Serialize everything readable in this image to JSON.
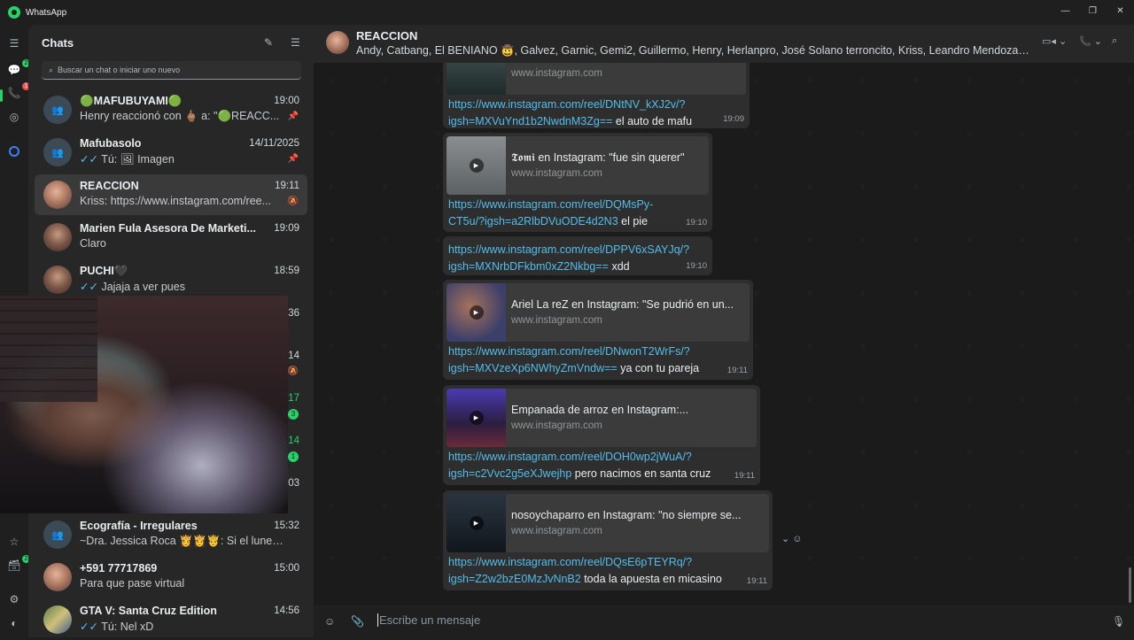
{
  "app": {
    "title": "WhatsApp",
    "window_controls": [
      "minimize",
      "maximize",
      "close"
    ]
  },
  "rail": {
    "badges": {
      "chats": "2",
      "calls": "1",
      "status_bottom": "2"
    },
    "icons": [
      "menu-icon",
      "chats-icon",
      "calls-icon",
      "status-icon",
      "meta-ai-icon",
      "starred-icon",
      "archived-icon",
      "settings-icon",
      "profile-icon"
    ]
  },
  "sidebar": {
    "title": "Chats",
    "search_placeholder": "Buscar un chat o iniciar uno nuevo",
    "chats": [
      {
        "name": "🟢MAFUBUYAMI🟢",
        "time": "19:00",
        "preview": "Henry reaccionó con 🖕🏽 a: \"🟢REACC...",
        "icon": "pin-icon"
      },
      {
        "name": "Mafubasolo",
        "time": "14/11/2025",
        "preview": "Tú: 🖼 Imagen",
        "ticks": "✓✓",
        "icon": "pin-icon"
      },
      {
        "name": "REACCION",
        "time": "19:11",
        "preview": "Kriss: https://www.instagram.com/ree...",
        "icon": "muted-icon"
      },
      {
        "name": "Marien Fula Asesora De Marketi...",
        "time": "19:09",
        "preview": "Claro"
      },
      {
        "name": "PUCHI🖤",
        "time": "18:59",
        "preview": "Jajaja a ver pues",
        "ticks": "✓✓"
      },
      {
        "time_fragment": "36"
      },
      {
        "time_fragment": "14"
      },
      {
        "time_fragment": "17",
        "unread": "3"
      },
      {
        "time_fragment": "14",
        "unread": "1"
      },
      {
        "time_fragment": "03"
      },
      {
        "name": "Ecografía - Irregulares",
        "time": "15:32",
        "preview": "~Dra. Jessica Roca 👸👸🤴: Si el lunes..."
      },
      {
        "name": "+591 77717869",
        "time": "15:00",
        "preview": "Para que pase virtual"
      },
      {
        "name": "GTA V: Santa Cruz Edition",
        "time": "14:56",
        "preview": "Tú: Nel xD",
        "ticks": "✓✓"
      }
    ]
  },
  "chat": {
    "name": "REACCION",
    "members": "Andy, Catbang, El BENIANO 🤠, Galvez, Garnic, Gemi2, Guillermo, Henry, Herlanpro, José Solano terroncito, Kriss, Leandro Mendoza, ..."
  },
  "messages": [
    {
      "card_domain": "www.instagram.com",
      "link": "https://www.instagram.com/reel/DNtNV_kXJ2v/?igsh=MXVuYnd1b2NwdnM3Zg==",
      "text": " el auto de mafu",
      "time": "19:09"
    },
    {
      "card_title": "𝕿𝖔𝖒𝖎 en Instagram: \"fue sin querer\"",
      "card_domain": "www.instagram.com",
      "link": "https://www.instagram.com/reel/DQMsPy-CT5u/?igsh=a2RlbDVuODE4d2N3",
      "text": " el pie",
      "time": "19:10"
    },
    {
      "link": "https://www.instagram.com/reel/DPPV6xSAYJq/?igsh=MXNrbDFkbm0xZ2Nkbg==",
      "text": " xdd",
      "time": "19:10"
    },
    {
      "card_title": "Ariel La reZ en Instagram: \"Se pudrió en un...",
      "card_domain": "www.instagram.com",
      "link": "https://www.instagram.com/reel/DNwonT2WrFs/?igsh=MXVzeXp6NWhyZmVndw==",
      "text": " ya con tu pareja",
      "time": "19:11"
    },
    {
      "card_title": "Empanada de arroz en Instagram:...",
      "card_domain": "www.instagram.com",
      "link": "https://www.instagram.com/reel/DOH0wp2jWuA/?igsh=c2Vvc2g5eXJwejhp",
      "text": " pero nacimos en santa cruz",
      "time": "19:11"
    },
    {
      "card_title": "nosoychaparro en Instagram: \"no siempre se...",
      "card_domain": "www.instagram.com",
      "link": "https://www.instagram.com/reel/DQsE6pTEYRq/?igsh=Z2w2bzE0MzJvNnB2",
      "text": " toda la apuesta en micasino",
      "time": "19:11"
    }
  ],
  "composer": {
    "placeholder": "Escribe un mensaje"
  }
}
